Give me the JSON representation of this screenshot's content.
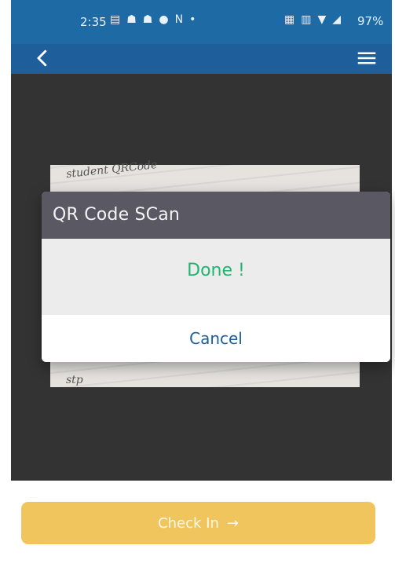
{
  "status": {
    "time": "2:35",
    "battery": "97%",
    "left_icons": [
      "message-icon",
      "snapchat-icon",
      "snapchat-icon",
      "chat-icon",
      "n-icon",
      "dot-icon"
    ],
    "right_icons": [
      "data-icon",
      "vibrate-icon",
      "wifi-icon",
      "signal-icon"
    ]
  },
  "appbar": {
    "back_icon": "chevron-left-icon",
    "menu_icon": "menu-icon"
  },
  "preview": {
    "note_top": "student\nQRCode",
    "note_bottom": "stp"
  },
  "dialog": {
    "title": "QR Code SCan",
    "status_text": "Done !",
    "cancel_label": "Cancel"
  },
  "primary_action": {
    "label": "Check In",
    "arrow": "→"
  },
  "colors": {
    "brand_blue": "#1d5e9b",
    "dialog_header": "#5a5862",
    "success_green": "#22b571",
    "button_yellow": "#f1c55e"
  }
}
